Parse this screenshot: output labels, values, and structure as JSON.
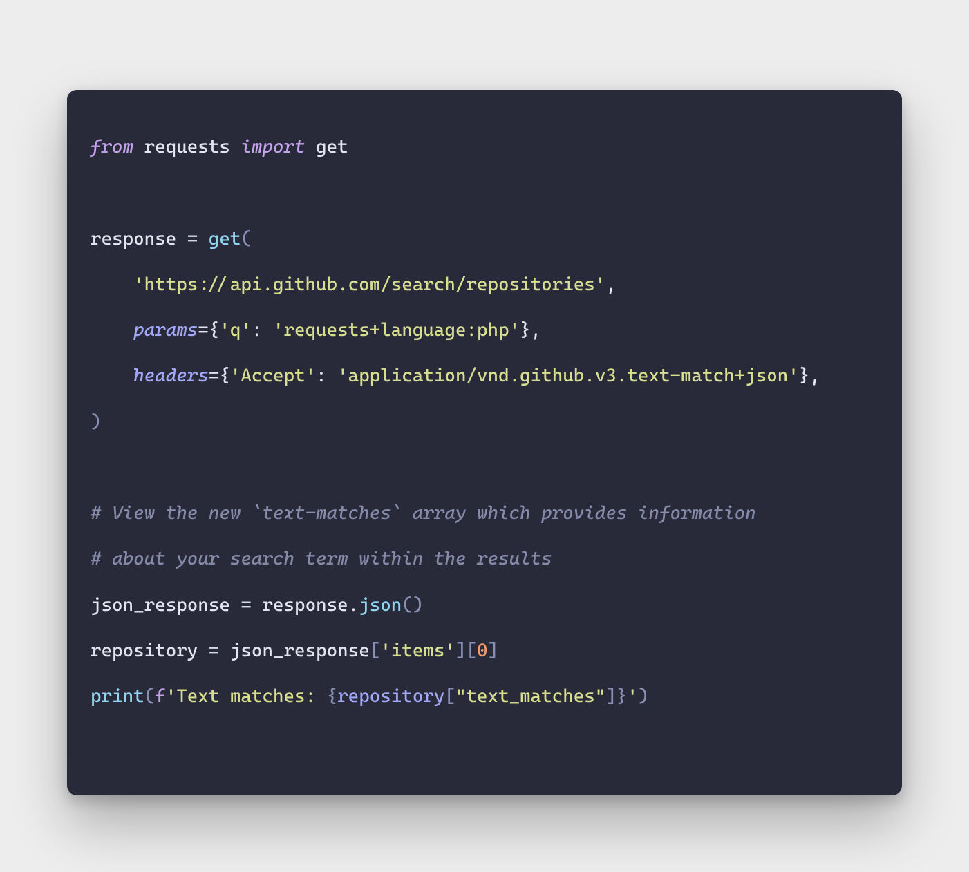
{
  "code": {
    "lang": "python",
    "kw_from": "from",
    "kw_import": "import",
    "mod_requests": "requests",
    "fn_get_import": "get",
    "var_response": "response",
    "eq": " = ",
    "fn_get_call": "get",
    "paren_open": "(",
    "paren_close": ")",
    "url": "'https://api.github.com/search/repositories'",
    "comma": ",",
    "arg_params": "params",
    "params_dict_open": "={",
    "params_key": "'q'",
    "colon": ":",
    "params_val": "'requests+language:php'",
    "dict_close": "}",
    "arg_headers": "headers",
    "headers_dict_open": "={",
    "headers_key": "'Accept'",
    "headers_val": "'application/vnd.github.v3.text-match+json'",
    "comment1": "# View the new `text-matches` array which provides information",
    "comment2": "# about your search term within the results",
    "var_json_response": "json_response",
    "fn_json": "json",
    "dot": ".",
    "empty_parens": "()",
    "var_repository": "repository",
    "idx_items_q1": "[",
    "idx_items_key": "'items'",
    "idx_items_q2": "]",
    "idx_zero_q1": "[",
    "idx_zero_val": "0",
    "idx_zero_q2": "]",
    "fn_print": "print",
    "f_prefix": "f",
    "fstr_open": "'",
    "fstr_text": "Text matches: ",
    "fstr_lbrace": "{",
    "fstr_var": "repository",
    "fstr_idx_open": "[",
    "fstr_idx_key": "\"text_matches\"",
    "fstr_idx_close": "]",
    "fstr_rbrace": "}",
    "fstr_close": "'"
  }
}
